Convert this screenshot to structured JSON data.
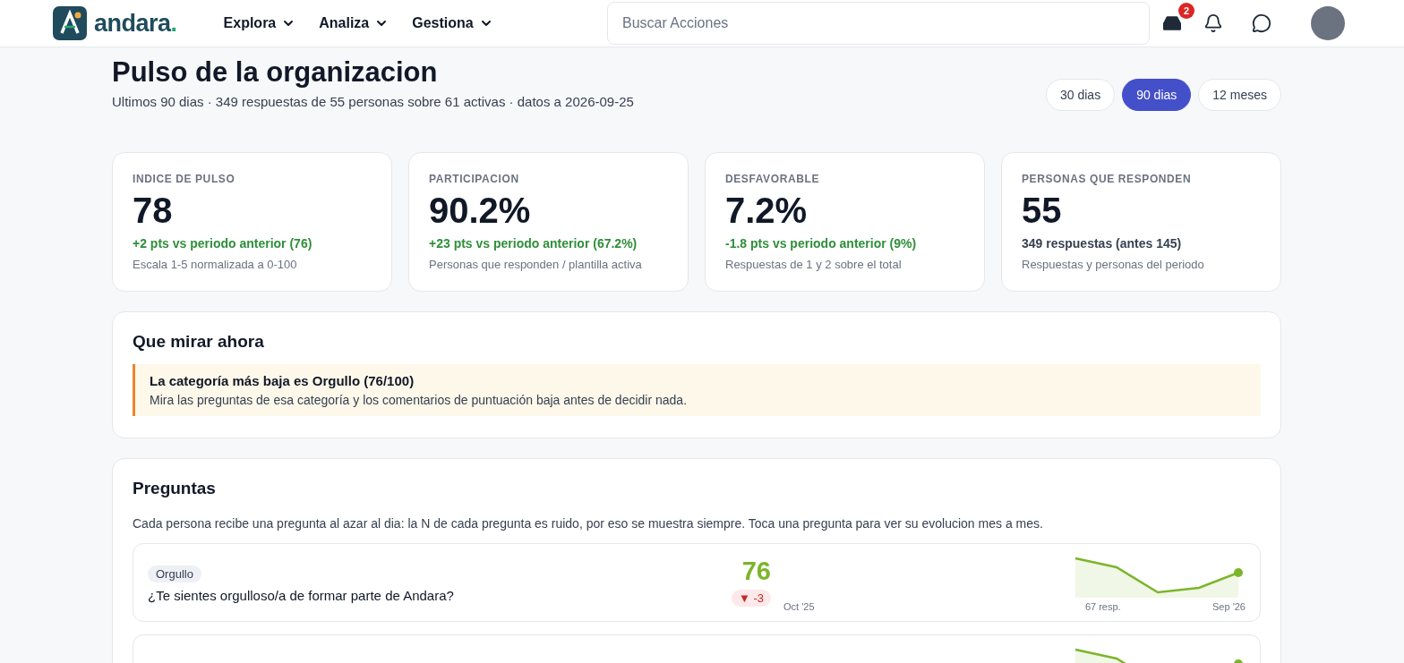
{
  "header": {
    "logo": "andara",
    "logo_dot": ".",
    "nav": [
      {
        "label": "Explora",
        "expanded": false
      },
      {
        "label": "Analiza",
        "expanded": false
      },
      {
        "label": "Gestiona",
        "expanded": false
      }
    ],
    "search": {
      "placeholder": "Buscar Acciones"
    },
    "inbox_badge": "2"
  },
  "page": {
    "title": "Pulso de la organizacion",
    "subtitle": "Ultimos 90 dias · 349 respuestas de 55 personas sobre 61 activas · datos a 2026-09-25",
    "ranges": [
      {
        "label": "30 dias",
        "selected": false
      },
      {
        "label": "90 dias",
        "selected": true
      },
      {
        "label": "12 meses",
        "selected": false
      }
    ]
  },
  "kpis": [
    {
      "label": "INDICE DE PULSO",
      "value": "78",
      "delta": "+2 pts vs periodo anterior (76)",
      "favorable": true,
      "note": "Escala 1-5 normalizada a 0-100"
    },
    {
      "label": "PARTICIPACION",
      "value": "90.2%",
      "delta": "+23 pts vs periodo anterior (67.2%)",
      "favorable": true,
      "note": "Personas que responden / plantilla activa"
    },
    {
      "label": "DESFAVORABLE",
      "value": "7.2%",
      "delta": "-1.8 pts vs periodo anterior (9%)",
      "favorable": true,
      "note": "Respuestas de 1 y 2 sobre el total"
    },
    {
      "label": "PERSONAS QUE RESPONDEN",
      "value": "55",
      "delta": "349 respuestas (antes 145)",
      "favorable": false,
      "note": "Respuestas y personas del periodo"
    }
  ],
  "focus": {
    "title": "Que mirar ahora",
    "alert": {
      "title": "La categoría más baja es Orgullo (76/100)",
      "body": "Mira las preguntas de esa categoría y los comentarios de puntuación baja antes de decidir nada."
    }
  },
  "questions": {
    "title": "Preguntas",
    "intro": "Cada persona recibe una pregunta al azar al dia: la N de cada pregunta es ruido, por eso se muestra siempre. Toca una pregunta para ver su evolucion mes a mes.",
    "items": [
      {
        "tag": "Orgullo",
        "text": "¿Te sientes orgulloso/a de formar parte de Andara?",
        "score": "76",
        "change": "▼ -3",
        "declined": true,
        "from": "Oct '25",
        "responses": "67 resp.",
        "to": "Sep '26"
      },
      {
        "partial": true
      }
    ]
  }
}
